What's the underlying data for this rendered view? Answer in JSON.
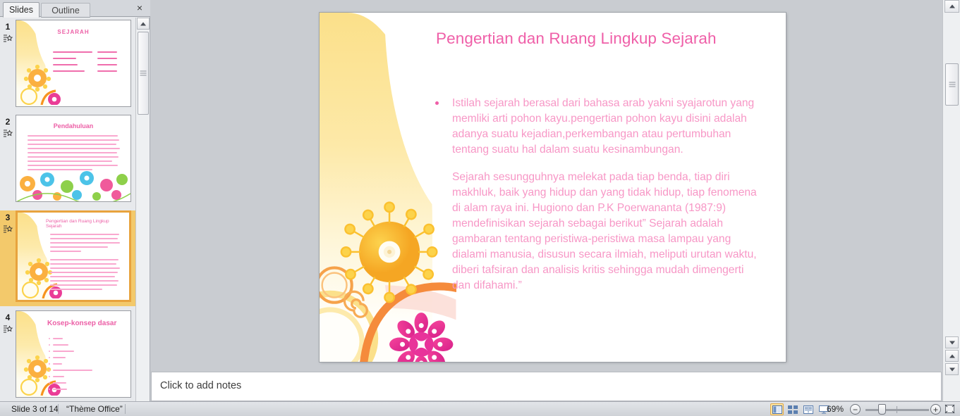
{
  "panel": {
    "tabs": [
      {
        "label": "Slides",
        "active": true
      },
      {
        "label": "Outline",
        "active": false
      }
    ],
    "close_icon": "×"
  },
  "thumbnails": [
    {
      "number": "1",
      "title": "SEJARAH",
      "selected": false,
      "lines": [
        "Fuad  Chaerin  Intan  Kamilia",
        "Izmila Vagumi",
        "Fajar Kurniawati",
        "Esme  Ramdani  Sukma"
      ],
      "ids": [
        "4815162342",
        "4815162346",
        "4815162347",
        "4815162349"
      ]
    },
    {
      "number": "2",
      "title": "Pendahuluan",
      "selected": false,
      "lines": [
        "Sejarah adalah kejadian yang terjadi pada masa lampau yang disusun",
        "berdasarkan peninggalan-peninggalan  berbagai peristiwa. Peninggalan",
        "peninggalan  itu disebut sumber sejarah. Dalam bahasa inggris, kata",
        "sejarah disebut  history, artinya masa lampau  masa lampau  umat manusia.",
        "Dalam bahasa arab, sejarah disebut tarikh atau syajarah, artinya pohon",
        "dan keturunan.  Diartikan membaca silsilah sejarah, dicantumkan  seperti",
        "pohon  pohon dari cabangnya dan berkembang  menjadi besar, maka",
        "sejarah dapat diartikan  silsilah keturunan  sejarah yang berarti peristiwa",
        "pemerintahan   keluarga raja pada masa lampau."
      ]
    },
    {
      "number": "3",
      "title": "Pengertian  dan Ruang Lingkup Sejarah",
      "selected": true,
      "lines": [
        "Istilah sejarah berasal dari bahasa arab yakni syajarotun",
        "yang memliki  arti pohon kayu.pengertian  pohon kayu",
        "disini adalah  adanya suatu kejadian,perkembangan   atau",
        "pertumbuhan   tentang suatu hal dalam suatu",
        "kesinambungan."
      ],
      "lines2": [
        "Sejarah sesungguhnya  melekat pada tiap benda, tiap diri",
        "makhluk,  baik yang hidup dan yang tidak hidup,  tiap",
        "fenomena di alam raya ini. Hugiono  dan P.K Poerwananta",
        "(1987:9)  mendefinisikan  sejarah sebagai berikut” Sejarah",
        "adalah gambaran tentang peristiwa-peristiwa  masa",
        "lampau  yang dialami manusia, disusun  secara ilmiah,",
        "meliputi  urutan waktu, diberi tafsiran dan analisis kritis",
        "sehingga  mudah dimengerti  dan difahami.”"
      ]
    },
    {
      "number": "4",
      "title": "Kosep-konsep dasar",
      "selected": false,
      "lines": [
        "Waktu",
        "Dokumen",
        "Kurun/tahun",
        "Silsilah",
        "Masa",
        "Perkembangan   peradaban",
        "Ruang",
        "Struktur",
        "Peristiwa"
      ]
    }
  ],
  "slide": {
    "title": "Pengertian dan Ruang Lingkup Sejarah",
    "paragraphs": [
      {
        "bulleted": true,
        "text": "Istilah sejarah berasal dari bahasa arab yakni syajarotun yang memliki  arti pohon kayu.pengertian  pohon kayu disini adalah adanya suatu kejadian,perkembangan  atau pertumbuhan  tentang suatu hal dalam suatu kesinambungan."
      },
      {
        "bulleted": false,
        "text": "Sejarah sesungguhnya  melekat pada tiap benda, tiap diri makhluk,  baik yang hidup dan yang tidak hidup,  tiap fenomena di alam raya ini. Hugiono  dan P.K Poerwananta (1987:9)  mendefinisikan  sejarah sebagai berikut” Sejarah adalah gambaran tentang peristiwa-peristiwa  masa lampau  yang dialami manusia, disusun  secara ilmiah, meliputi  urutan waktu, diberi tafsiran dan analisis kritis sehingga  mudah dimengerti  dan difahami.”"
      }
    ],
    "colors": {
      "title": "#ef5fa8",
      "body": "#f797c6",
      "band": "#fbe08a",
      "sun": "#f9b233",
      "flower": "#ea3d97"
    }
  },
  "notes": {
    "placeholder": "Click to add notes"
  },
  "statusbar": {
    "slide_indicator": "Slide 3 of 14",
    "theme": "“Thème Office”",
    "zoom_level": "69%",
    "zoom_out_icon": "−",
    "zoom_in_icon": "+",
    "views": [
      {
        "name": "normal",
        "selected": true
      },
      {
        "name": "slide-sorter",
        "selected": false
      },
      {
        "name": "reading-view",
        "selected": false
      },
      {
        "name": "slide-show",
        "selected": false
      }
    ]
  }
}
